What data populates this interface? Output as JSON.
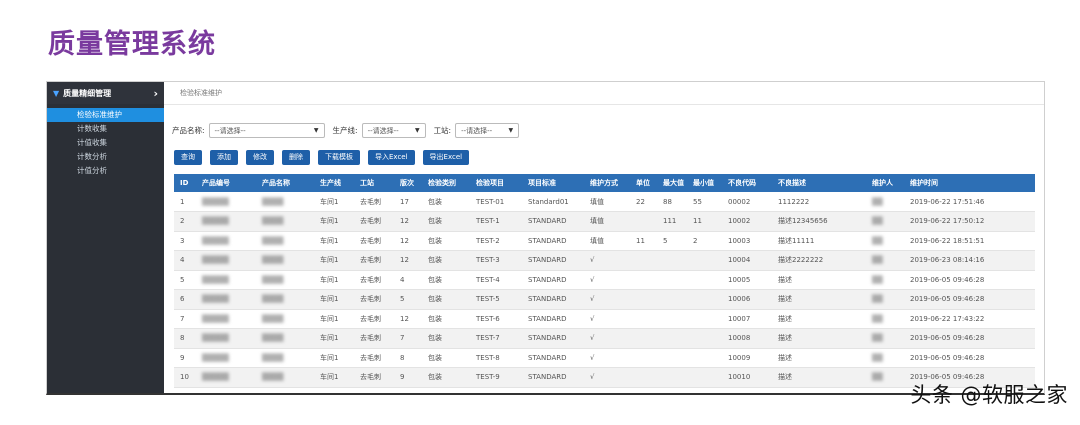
{
  "page_title": "质量管理系统",
  "sidebar": {
    "header": "质量精细管理",
    "items": [
      "检验标准维护",
      "计数收集",
      "计值收集",
      "计数分析",
      "计值分析"
    ],
    "active_index": 0
  },
  "breadcrumb": "检验标准维护",
  "filters": [
    {
      "label": "产品名称:",
      "value": "--请选择--"
    },
    {
      "label": "生产线:",
      "value": "--请选择--"
    },
    {
      "label": "工站:",
      "value": "--请选择--"
    }
  ],
  "buttons": [
    "查询",
    "添加",
    "修改",
    "删除",
    "下载模板",
    "导入Excel",
    "导出Excel"
  ],
  "table": {
    "headers": [
      "ID",
      "产品编号",
      "产品名称",
      "生产线",
      "工站",
      "版次",
      "检验类别",
      "检验项目",
      "项目标准",
      "维护方式",
      "单位",
      "最大值",
      "最小值",
      "不良代码",
      "不良描述",
      "维护人",
      "维护时间"
    ],
    "rows": [
      [
        "1",
        "▒▒▒▒▒",
        "▒▒▒▒",
        "车间1",
        "去毛刺",
        "17",
        "包装",
        "TEST-01",
        "Standard01",
        "填值",
        "22",
        "88",
        "55",
        "00002",
        "1112222",
        "▒▒",
        "2019-06-22 17:51:46"
      ],
      [
        "2",
        "▒▒▒▒▒",
        "▒▒▒▒",
        "车间1",
        "去毛刺",
        "12",
        "包装",
        "TEST-1",
        "STANDARD",
        "填值",
        "",
        "111",
        "11",
        "10002",
        "描述12345656",
        "▒▒",
        "2019-06-22 17:50:12"
      ],
      [
        "3",
        "▒▒▒▒▒",
        "▒▒▒▒",
        "车间1",
        "去毛刺",
        "12",
        "包装",
        "TEST-2",
        "STANDARD",
        "填值",
        "11",
        "5",
        "2",
        "10003",
        "描述11111",
        "▒▒",
        "2019-06-22 18:51:51"
      ],
      [
        "4",
        "▒▒▒▒▒",
        "▒▒▒▒",
        "车间1",
        "去毛刺",
        "12",
        "包装",
        "TEST-3",
        "STANDARD",
        "√",
        "",
        "",
        "",
        "10004",
        "描述2222222",
        "▒▒",
        "2019-06-23 08:14:16"
      ],
      [
        "5",
        "▒▒▒▒▒",
        "▒▒▒▒",
        "车间1",
        "去毛刺",
        "4",
        "包装",
        "TEST-4",
        "STANDARD",
        "√",
        "",
        "",
        "",
        "10005",
        "描述",
        "▒▒",
        "2019-06-05 09:46:28"
      ],
      [
        "6",
        "▒▒▒▒▒",
        "▒▒▒▒",
        "车间1",
        "去毛刺",
        "5",
        "包装",
        "TEST-5",
        "STANDARD",
        "√",
        "",
        "",
        "",
        "10006",
        "描述",
        "▒▒",
        "2019-06-05 09:46:28"
      ],
      [
        "7",
        "▒▒▒▒▒",
        "▒▒▒▒",
        "车间1",
        "去毛刺",
        "12",
        "包装",
        "TEST-6",
        "STANDARD",
        "√",
        "",
        "",
        "",
        "10007",
        "描述",
        "▒▒",
        "2019-06-22 17:43:22"
      ],
      [
        "8",
        "▒▒▒▒▒",
        "▒▒▒▒",
        "车间1",
        "去毛刺",
        "7",
        "包装",
        "TEST-7",
        "STANDARD",
        "√",
        "",
        "",
        "",
        "10008",
        "描述",
        "▒▒",
        "2019-06-05 09:46:28"
      ],
      [
        "9",
        "▒▒▒▒▒",
        "▒▒▒▒",
        "车间1",
        "去毛刺",
        "8",
        "包装",
        "TEST-8",
        "STANDARD",
        "√",
        "",
        "",
        "",
        "10009",
        "描述",
        "▒▒",
        "2019-06-05 09:46:28"
      ],
      [
        "10",
        "▒▒▒▒▒",
        "▒▒▒▒",
        "车间1",
        "去毛刺",
        "9",
        "包装",
        "TEST-9",
        "STANDARD",
        "√",
        "",
        "",
        "",
        "10010",
        "描述",
        "▒▒",
        "2019-06-05 09:46:28"
      ]
    ]
  },
  "watermark": "头条 @软服之家",
  "colors": {
    "title": "#7a3a9e",
    "sidebar_bg": "#2b2f36",
    "active_item": "#1f8fe0",
    "button": "#1e5fa8",
    "table_header": "#2d6fb5"
  }
}
